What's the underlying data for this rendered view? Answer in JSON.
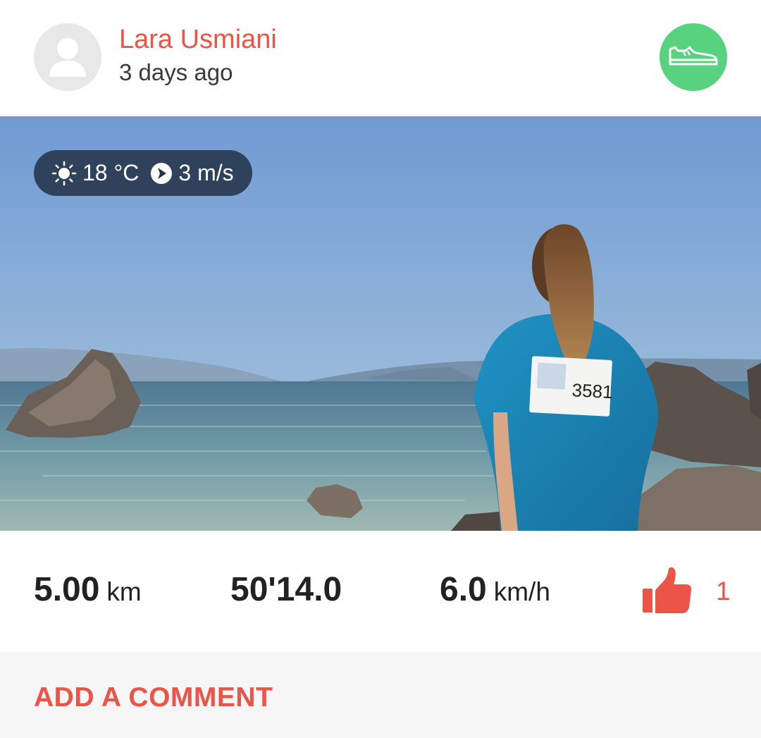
{
  "colors": {
    "accent": "#ea5548",
    "badge_green": "#58d27f"
  },
  "header": {
    "user_name": "Lara Usmiani",
    "timestamp": "3 days ago",
    "avatar_icon": "default-user-icon",
    "activity_icon": "shoe-icon"
  },
  "weather": {
    "sun_icon": "sun-icon",
    "temperature": "18 °C",
    "wind_icon": "wind-direction-icon",
    "wind_speed": "3 m/s"
  },
  "stats": {
    "distance_value": "5.00",
    "distance_unit": "km",
    "duration_value": "50'14.0",
    "speed_value": "6.0",
    "speed_unit": "km/h",
    "like_icon": "thumbs-up-icon",
    "like_count": "1"
  },
  "comment": {
    "label": "ADD A COMMENT"
  },
  "photo": {
    "description_icon": "activity-photo",
    "bib_number": "3581"
  }
}
